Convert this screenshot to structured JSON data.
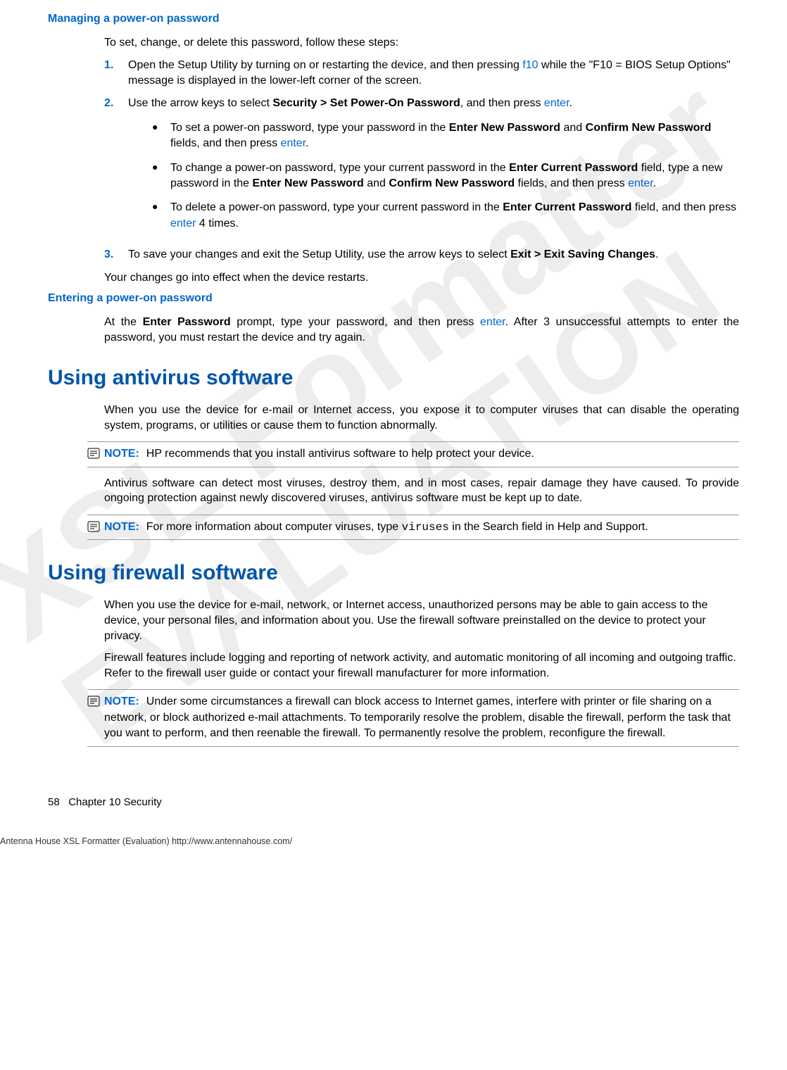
{
  "watermark_line1": "XSL Formatter",
  "watermark_line2": "EVALUATION",
  "section1": {
    "heading": "Managing a power-on password",
    "intro": "To set, change, or delete this password, follow these steps:",
    "step1_num": "1.",
    "step1_a": "Open the Setup Utility by turning on or restarting the device, and then pressing ",
    "step1_key": "f10",
    "step1_b": " while the \"F10 = BIOS Setup Options\" message is displayed in the lower-left corner of the screen.",
    "step2_num": "2.",
    "step2_a": "Use the arrow keys to select ",
    "step2_bold": "Security > Set Power-On Password",
    "step2_b": ", and then press ",
    "step2_key": "enter",
    "step2_c": ".",
    "b1_a": "To set a power-on password, type your password in the ",
    "b1_bold1": "Enter New Password",
    "b1_mid": " and ",
    "b1_bold2": "Confirm New Password",
    "b1_b": " fields, and then press ",
    "b1_key": "enter",
    "b1_c": ".",
    "b2_a": "To change a power-on password, type your current password in the ",
    "b2_bold1": "Enter Current Password",
    "b2_mid1": " field, type a new password in the ",
    "b2_bold2": "Enter New Password",
    "b2_mid2": " and ",
    "b2_bold3": "Confirm New Password",
    "b2_b": " fields, and then press ",
    "b2_key": "enter",
    "b2_c": ".",
    "b3_a": "To delete a power-on password, type your current password in the ",
    "b3_bold1": "Enter Current Password",
    "b3_b": " field, and then press ",
    "b3_key": "enter",
    "b3_c": " 4 times.",
    "step3_num": "3.",
    "step3_a": "To save your changes and exit the Setup Utility, use the arrow keys to select ",
    "step3_bold": "Exit > Exit Saving Changes",
    "step3_b": ".",
    "outro": "Your changes go into effect when the device restarts."
  },
  "section2": {
    "heading": "Entering a power-on password",
    "p1_a": "At the ",
    "p1_bold": "Enter Password",
    "p1_b": " prompt, type your password, and then press ",
    "p1_key": "enter",
    "p1_c": ". After 3 unsuccessful attempts to enter the password, you must restart the device and try again."
  },
  "section3": {
    "heading": "Using antivirus software",
    "p1": "When you use the device for e-mail or Internet access, you expose it to computer viruses that can disable the operating system, programs, or utilities or cause them to function abnormally.",
    "note1_label": "NOTE:",
    "note1_text": "HP recommends that you install antivirus software to help protect your device.",
    "p2": "Antivirus software can detect most viruses, destroy them, and in most cases, repair damage they have caused. To provide ongoing protection against newly discovered viruses, antivirus software must be kept up to date.",
    "note2_label": "NOTE:",
    "note2_a": "For more information about computer viruses, type ",
    "note2_code": "viruses",
    "note2_b": " in the Search field in Help and Support."
  },
  "section4": {
    "heading": "Using firewall software",
    "p1": "When you use the device for e-mail, network, or Internet access, unauthorized persons may be able to gain access to the device, your personal files, and information about you. Use the firewall software preinstalled on the device to protect your privacy.",
    "p2": "Firewall features include logging and reporting of network activity, and automatic monitoring of all incoming and outgoing traffic. Refer to the firewall user guide or contact your firewall manufacturer for more information.",
    "note1_label": "NOTE:",
    "note1_text": "Under some circumstances a firewall can block access to Internet games, interfere with printer or file sharing on a network, or block authorized e-mail attachments. To temporarily resolve the problem, disable the firewall, perform the task that you want to perform, and then reenable the firewall. To permanently resolve the problem, reconfigure the firewall."
  },
  "footer": {
    "page": "58",
    "chapter": "Chapter 10   Security",
    "formatter": "Antenna House XSL Formatter (Evaluation)  http://www.antennahouse.com/"
  }
}
